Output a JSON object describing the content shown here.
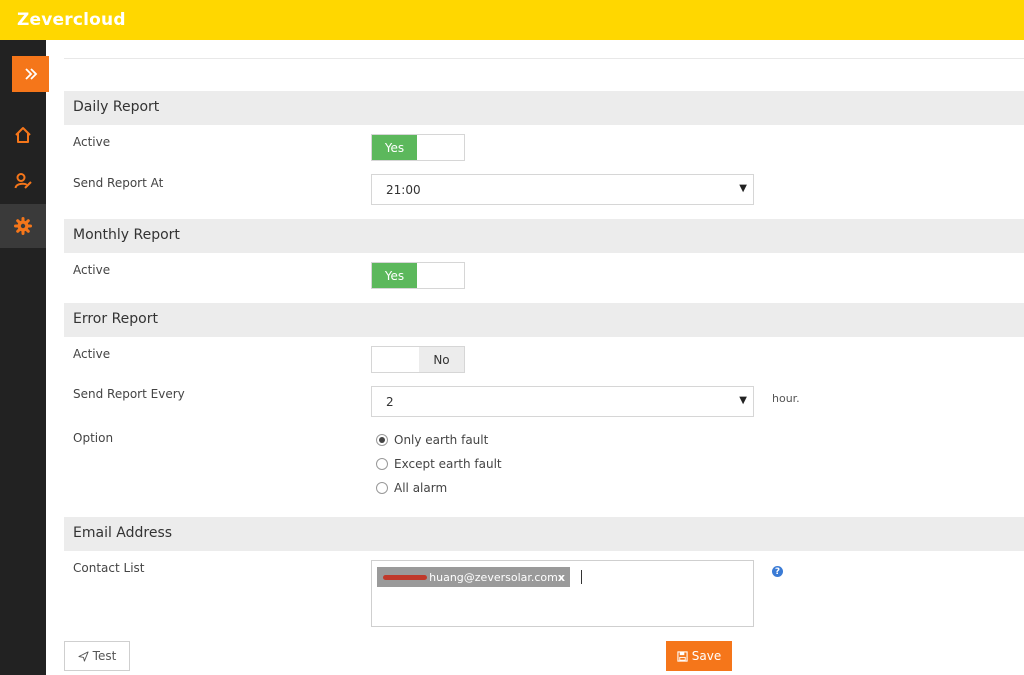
{
  "app": {
    "brand": "Zevercloud"
  },
  "colors": {
    "brand": "#ffd700",
    "accent": "#f5761a",
    "toggle_on": "#5cb85c",
    "sidebar": "#222222"
  },
  "sidebar": {
    "toggle_icon": "double-chevron-right-icon",
    "items": [
      {
        "icon": "home-icon",
        "active": false
      },
      {
        "icon": "user-edit-icon",
        "active": false
      },
      {
        "icon": "gear-icon",
        "active": true
      }
    ]
  },
  "daily_report": {
    "title": "Daily Report",
    "active_label": "Active",
    "active_value": "Yes",
    "send_at_label": "Send Report At",
    "send_at_value": "21:00"
  },
  "monthly_report": {
    "title": "Monthly Report",
    "active_label": "Active",
    "active_value": "Yes"
  },
  "error_report": {
    "title": "Error Report",
    "active_label": "Active",
    "active_value": "No",
    "send_every_label": "Send Report Every",
    "send_every_value": "2",
    "send_every_suffix": "hour.",
    "option_label": "Option",
    "options": [
      {
        "label": "Only earth fault",
        "checked": true
      },
      {
        "label": "Except earth fault",
        "checked": false
      },
      {
        "label": "All alarm",
        "checked": false
      }
    ]
  },
  "email": {
    "title": "Email Address",
    "contact_label": "Contact List",
    "contact_tag": "huang@zeversolar.com",
    "remove_symbol": "x",
    "help_symbol": "?"
  },
  "buttons": {
    "test_label": "Test",
    "save_label": "Save"
  }
}
